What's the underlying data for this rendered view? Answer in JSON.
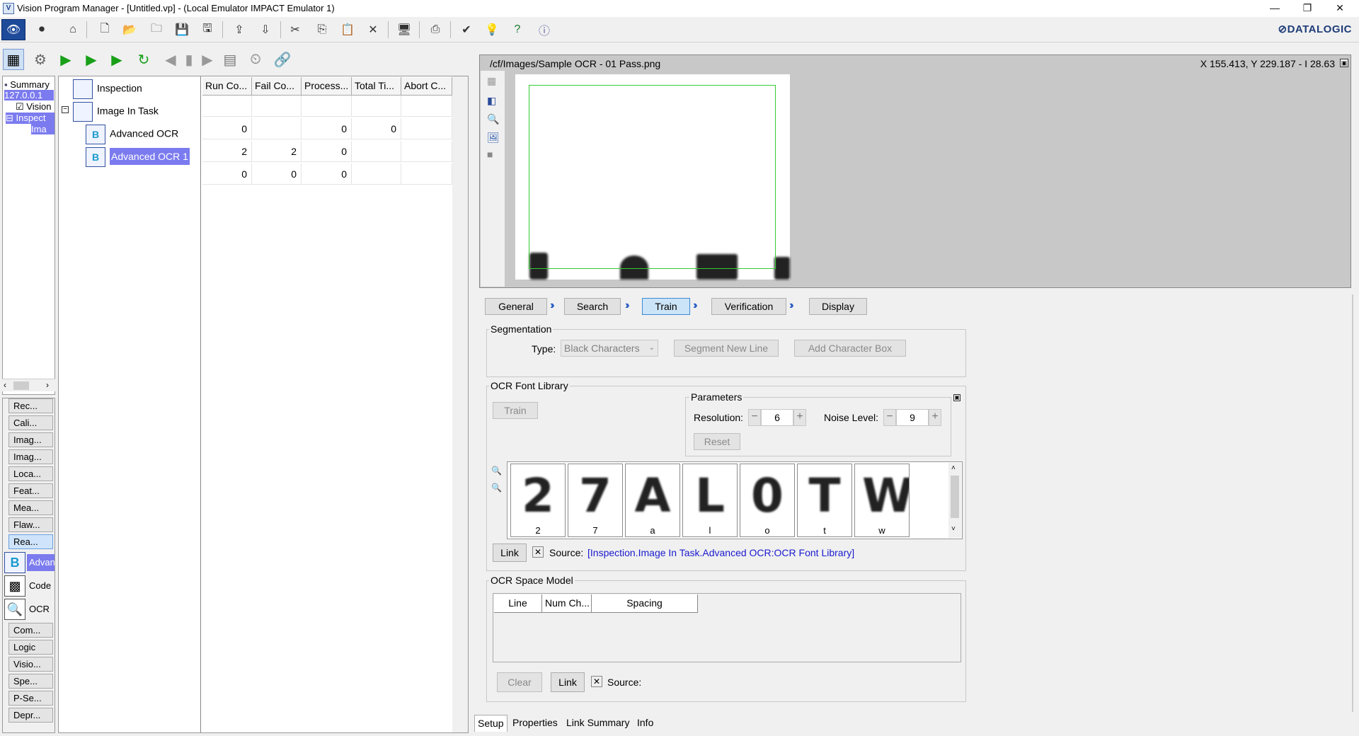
{
  "window": {
    "title": "Vision Program Manager - [Untitled.vp] - (Local Emulator IMPACT Emulator 1)",
    "minimize": "—",
    "restore": "❐",
    "close": "✕"
  },
  "brand": {
    "logo_text": "⊘DATALOGIC"
  },
  "left_tree": {
    "items": [
      "Summary",
      "127.0.0.1",
      "Vision",
      "Inspect",
      "Ima"
    ]
  },
  "tool_categories": {
    "buttons_top": [
      "Rec...",
      "Cali...",
      "Imag...",
      "Imag...",
      "Loca...",
      "Feat...",
      "Mea...",
      "Flaw...",
      "Rea..."
    ],
    "tools": [
      "Advan",
      "Code",
      "OCR"
    ],
    "buttons_bottom": [
      "Com...",
      "Logic",
      "Visio...",
      "Spe...",
      "P-Se...",
      "Depr..."
    ]
  },
  "task_table": {
    "columns": [
      "Run Co...",
      "Fail Co...",
      "Process...",
      "Total Ti...",
      "Abort C..."
    ],
    "rows": [
      {
        "name": "Inspection",
        "values": [
          "",
          "",
          "",
          "",
          ""
        ]
      },
      {
        "name": "Image In Task",
        "values": [
          "0",
          "",
          "0",
          "0",
          ""
        ]
      },
      {
        "name": "Advanced OCR",
        "values": [
          "2",
          "2",
          "0",
          "",
          ""
        ]
      },
      {
        "name": "Advanced OCR 1",
        "values": [
          "0",
          "0",
          "0",
          "",
          ""
        ]
      }
    ]
  },
  "viewer": {
    "path": "/cf/Images/Sample OCR - 01 Pass.png",
    "coords": "X 155.413,  Y 229.187  -  I 28.63"
  },
  "wizard": {
    "steps": [
      "General",
      "Search",
      "Train",
      "Verification",
      "Display"
    ],
    "active": "Train"
  },
  "segmentation": {
    "title": "Segmentation",
    "type_label": "Type:",
    "type_value": "Black Characters",
    "segment_new_line": "Segment New Line",
    "add_character_box": "Add Character Box"
  },
  "font_library": {
    "title": "OCR Font Library",
    "train": "Train",
    "parameters_title": "Parameters",
    "resolution_label": "Resolution:",
    "resolution_value": "6",
    "noise_label": "Noise Level:",
    "noise_value": "9",
    "reset": "Reset",
    "characters": [
      {
        "glyph": "2",
        "label": "2"
      },
      {
        "glyph": "7",
        "label": "7"
      },
      {
        "glyph": "A",
        "label": "a"
      },
      {
        "glyph": "L",
        "label": "l"
      },
      {
        "glyph": "0",
        "label": "o"
      },
      {
        "glyph": "T",
        "label": "t"
      },
      {
        "glyph": "W",
        "label": "w"
      }
    ],
    "link": "Link",
    "source_label": "Source:",
    "source_value": "[Inspection.Image In Task.Advanced OCR:OCR Font Library]"
  },
  "space_model": {
    "title": "OCR Space Model",
    "columns": [
      "Line",
      "Num Ch...",
      "Spacing"
    ],
    "clear": "Clear",
    "link": "Link",
    "source_label": "Source:"
  },
  "bottom_tabs": [
    "Setup",
    "Properties",
    "Link Summary",
    "Info"
  ]
}
